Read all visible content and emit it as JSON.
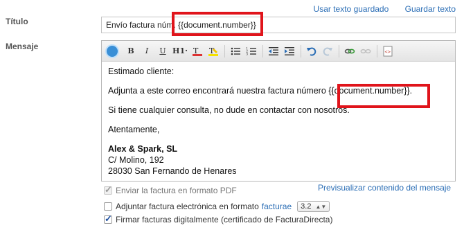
{
  "header_links": {
    "use_saved": "Usar texto guardado",
    "save": "Guardar texto"
  },
  "labels": {
    "title": "Título",
    "message": "Mensaje"
  },
  "title_field": {
    "value": "Envío factura núm. {{document.number}}"
  },
  "toolbar": {
    "bold": "B",
    "italic": "I",
    "underline": "U",
    "heading": "H1·"
  },
  "message": {
    "greeting": "Estimado cliente:",
    "line1": "Adjunta a este correo encontrará nuestra factura número {{document.number}}.",
    "line2": "Si tiene cualquier consulta, no dude en contactar con nosotros.",
    "closing": "Atentamente,",
    "company": "Alex & Spark, SL",
    "address1": "C/ Molino, 192",
    "address2": "28030 San Fernando de Henares"
  },
  "preview_link": "Previsualizar contenido del mensaje",
  "options": {
    "pdf": {
      "label": "Enviar la factura en formato PDF",
      "checked": true,
      "disabled": true
    },
    "electronic": {
      "label_before": "Adjuntar factura electrónica en formato",
      "link": "facturae",
      "version": "3.2",
      "checked": false
    },
    "sign": {
      "label": "Firmar facturas digitalmente (certificado de FacturaDirecta)",
      "checked": true
    }
  }
}
